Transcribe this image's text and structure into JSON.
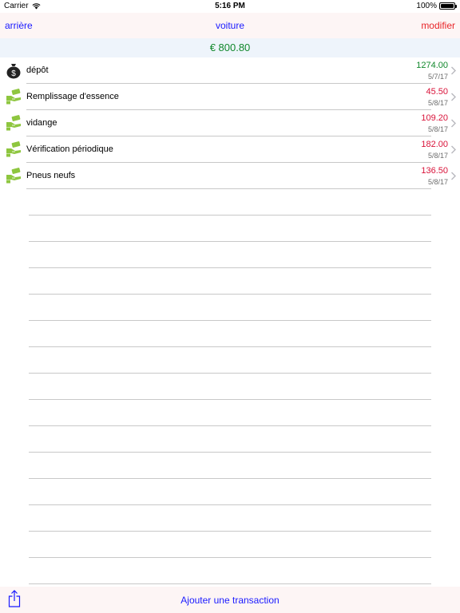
{
  "status_bar": {
    "carrier": "Carrier",
    "time": "5:16 PM",
    "battery": "100%",
    "battery_level": 1.0
  },
  "nav": {
    "back_label": "arrière",
    "title": "voiture",
    "edit_label": "modifier"
  },
  "balance": {
    "text": "€ 800.80",
    "color": "#11882c"
  },
  "colors": {
    "income": "#11882c",
    "expense": "#d9133a",
    "link": "#1a1aff",
    "edit": "#e8262a",
    "expense_icon": "#8ec63f"
  },
  "transactions": [
    {
      "label": "dépôt",
      "amount": "1274.00",
      "date": "5/7/17",
      "type": "income",
      "icon": "money-bag-icon"
    },
    {
      "label": "Remplissage d'essence",
      "amount": "45.50",
      "date": "5/8/17",
      "type": "expense",
      "icon": "hand-money-icon"
    },
    {
      "label": "vidange",
      "amount": "109.20",
      "date": "5/8/17",
      "type": "expense",
      "icon": "hand-money-icon"
    },
    {
      "label": "Vérification périodique",
      "amount": "182.00",
      "date": "5/8/17",
      "type": "expense",
      "icon": "hand-money-icon"
    },
    {
      "label": "Pneus neufs",
      "amount": "136.50",
      "date": "5/8/17",
      "type": "expense",
      "icon": "hand-money-icon"
    }
  ],
  "toolbar": {
    "share_icon": "share-icon",
    "add_label": "Ajouter une transaction"
  }
}
